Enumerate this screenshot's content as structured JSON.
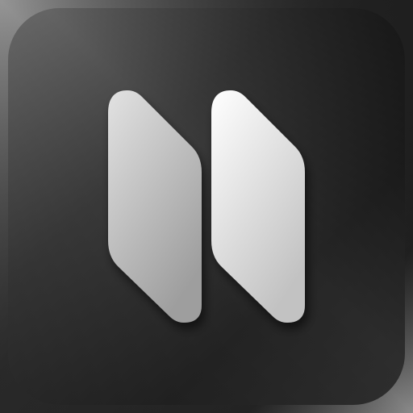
{
  "icon": {
    "name": "app-icon",
    "glyph": "pause-icon",
    "colors": {
      "outer_light": "#8f8f8f",
      "outer_dark": "#1a1a1a",
      "tile_top_left": "#6a6a6a",
      "tile_mid": "#2e2e2e",
      "tile_bottom_right": "#1e1e1e",
      "bar_light": "#ffffff",
      "bar_shade": "#9c9c9c"
    }
  }
}
